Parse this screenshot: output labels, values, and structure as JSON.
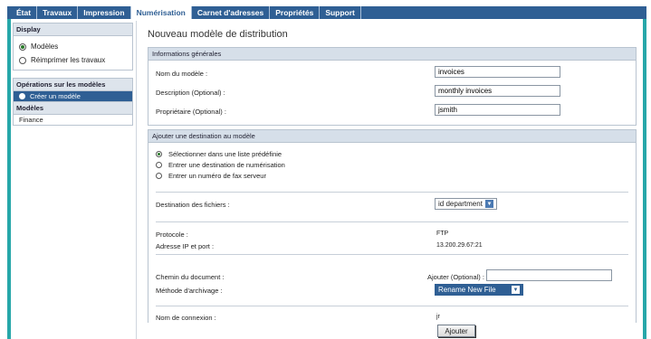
{
  "nav": {
    "tabs": [
      "État",
      "Travaux",
      "Impression",
      "Numérisation",
      "Carnet d'adresses",
      "Propriétés",
      "Support"
    ],
    "active_index": 3
  },
  "sidebar": {
    "display_title": "Display",
    "display_options": [
      "Modèles",
      "Réimprimer les travaux"
    ],
    "ops_title": "Opérations sur les modèles",
    "create_label": "Créer un modèle",
    "models_title": "Modèles",
    "models": [
      "Finance"
    ]
  },
  "main": {
    "page_title": "Nouveau modèle de distribution",
    "general": {
      "title": "Informations générales",
      "name_label": "Nom du modèle :",
      "name_value": "invoices",
      "desc_label": "Description (Optional) :",
      "desc_value": "monthly invoices",
      "owner_label": "Propriétaire (Optional) :",
      "owner_value": "jsmith"
    },
    "destination": {
      "title": "Ajouter une destination au modèle",
      "options": [
        "Sélectionner dans une liste prédéfinie",
        "Entrer une destination de numérisation",
        "Entrer un numéro de fax serveur"
      ],
      "dest_label": "Destination des fichiers :",
      "dest_value": "id department",
      "protocol_label": "Protocole :",
      "protocol_value": "FTP",
      "ip_label": "Adresse IP et port :",
      "ip_value": "13.200.29.67:21",
      "path_label": "Chemin du document :",
      "add_optional_label": "Ajouter (Optional) :",
      "path_value": "",
      "archive_label": "Méthode d'archivage :",
      "archive_value": "Rename New File",
      "login_label": "Nom de connexion :",
      "login_value": "jr"
    },
    "add_button": "Ajouter"
  }
}
